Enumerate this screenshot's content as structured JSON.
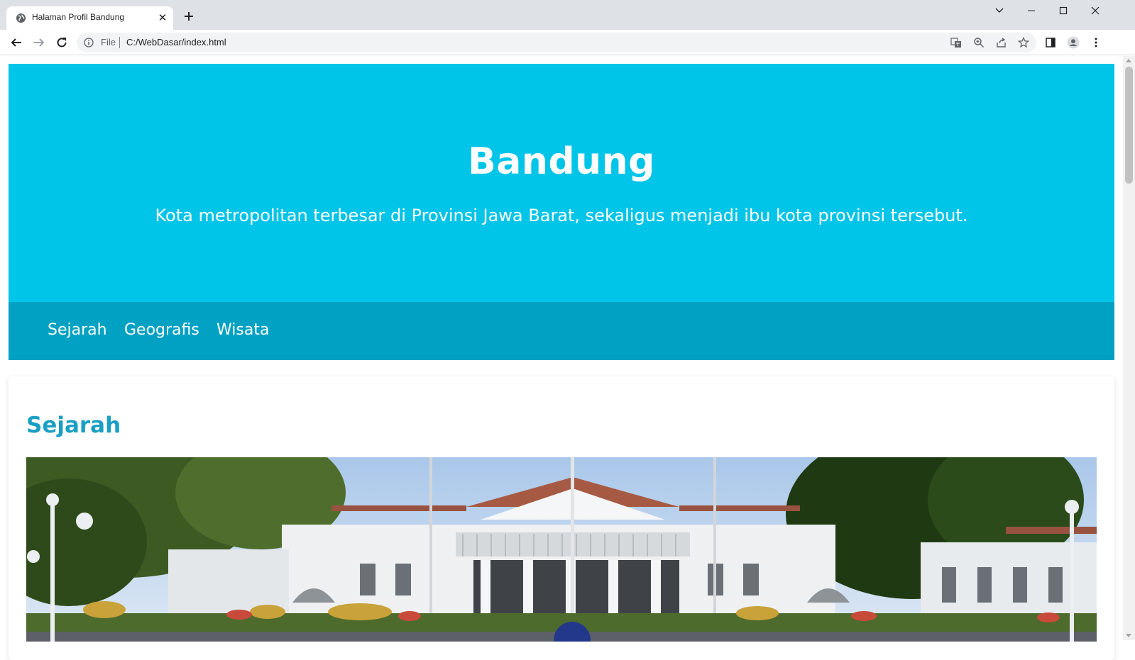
{
  "browser": {
    "tab_title": "Halaman Profil Bandung",
    "address": {
      "scheme_label": "File",
      "url": "C:/WebDasar/index.html"
    }
  },
  "page": {
    "header": {
      "title": "Bandung",
      "subtitle": "Kota metropolitan terbesar di Provinsi Jawa Barat, sekaligus menjadi ibu kota provinsi tersebut."
    },
    "nav": [
      {
        "label": "Sejarah"
      },
      {
        "label": "Geografis"
      },
      {
        "label": "Wisata"
      }
    ],
    "section": {
      "title": "Sejarah"
    }
  },
  "colors": {
    "header_bg": "#00c4e8",
    "nav_bg": "#00a1c2",
    "section_title": "#1a9fc4"
  }
}
